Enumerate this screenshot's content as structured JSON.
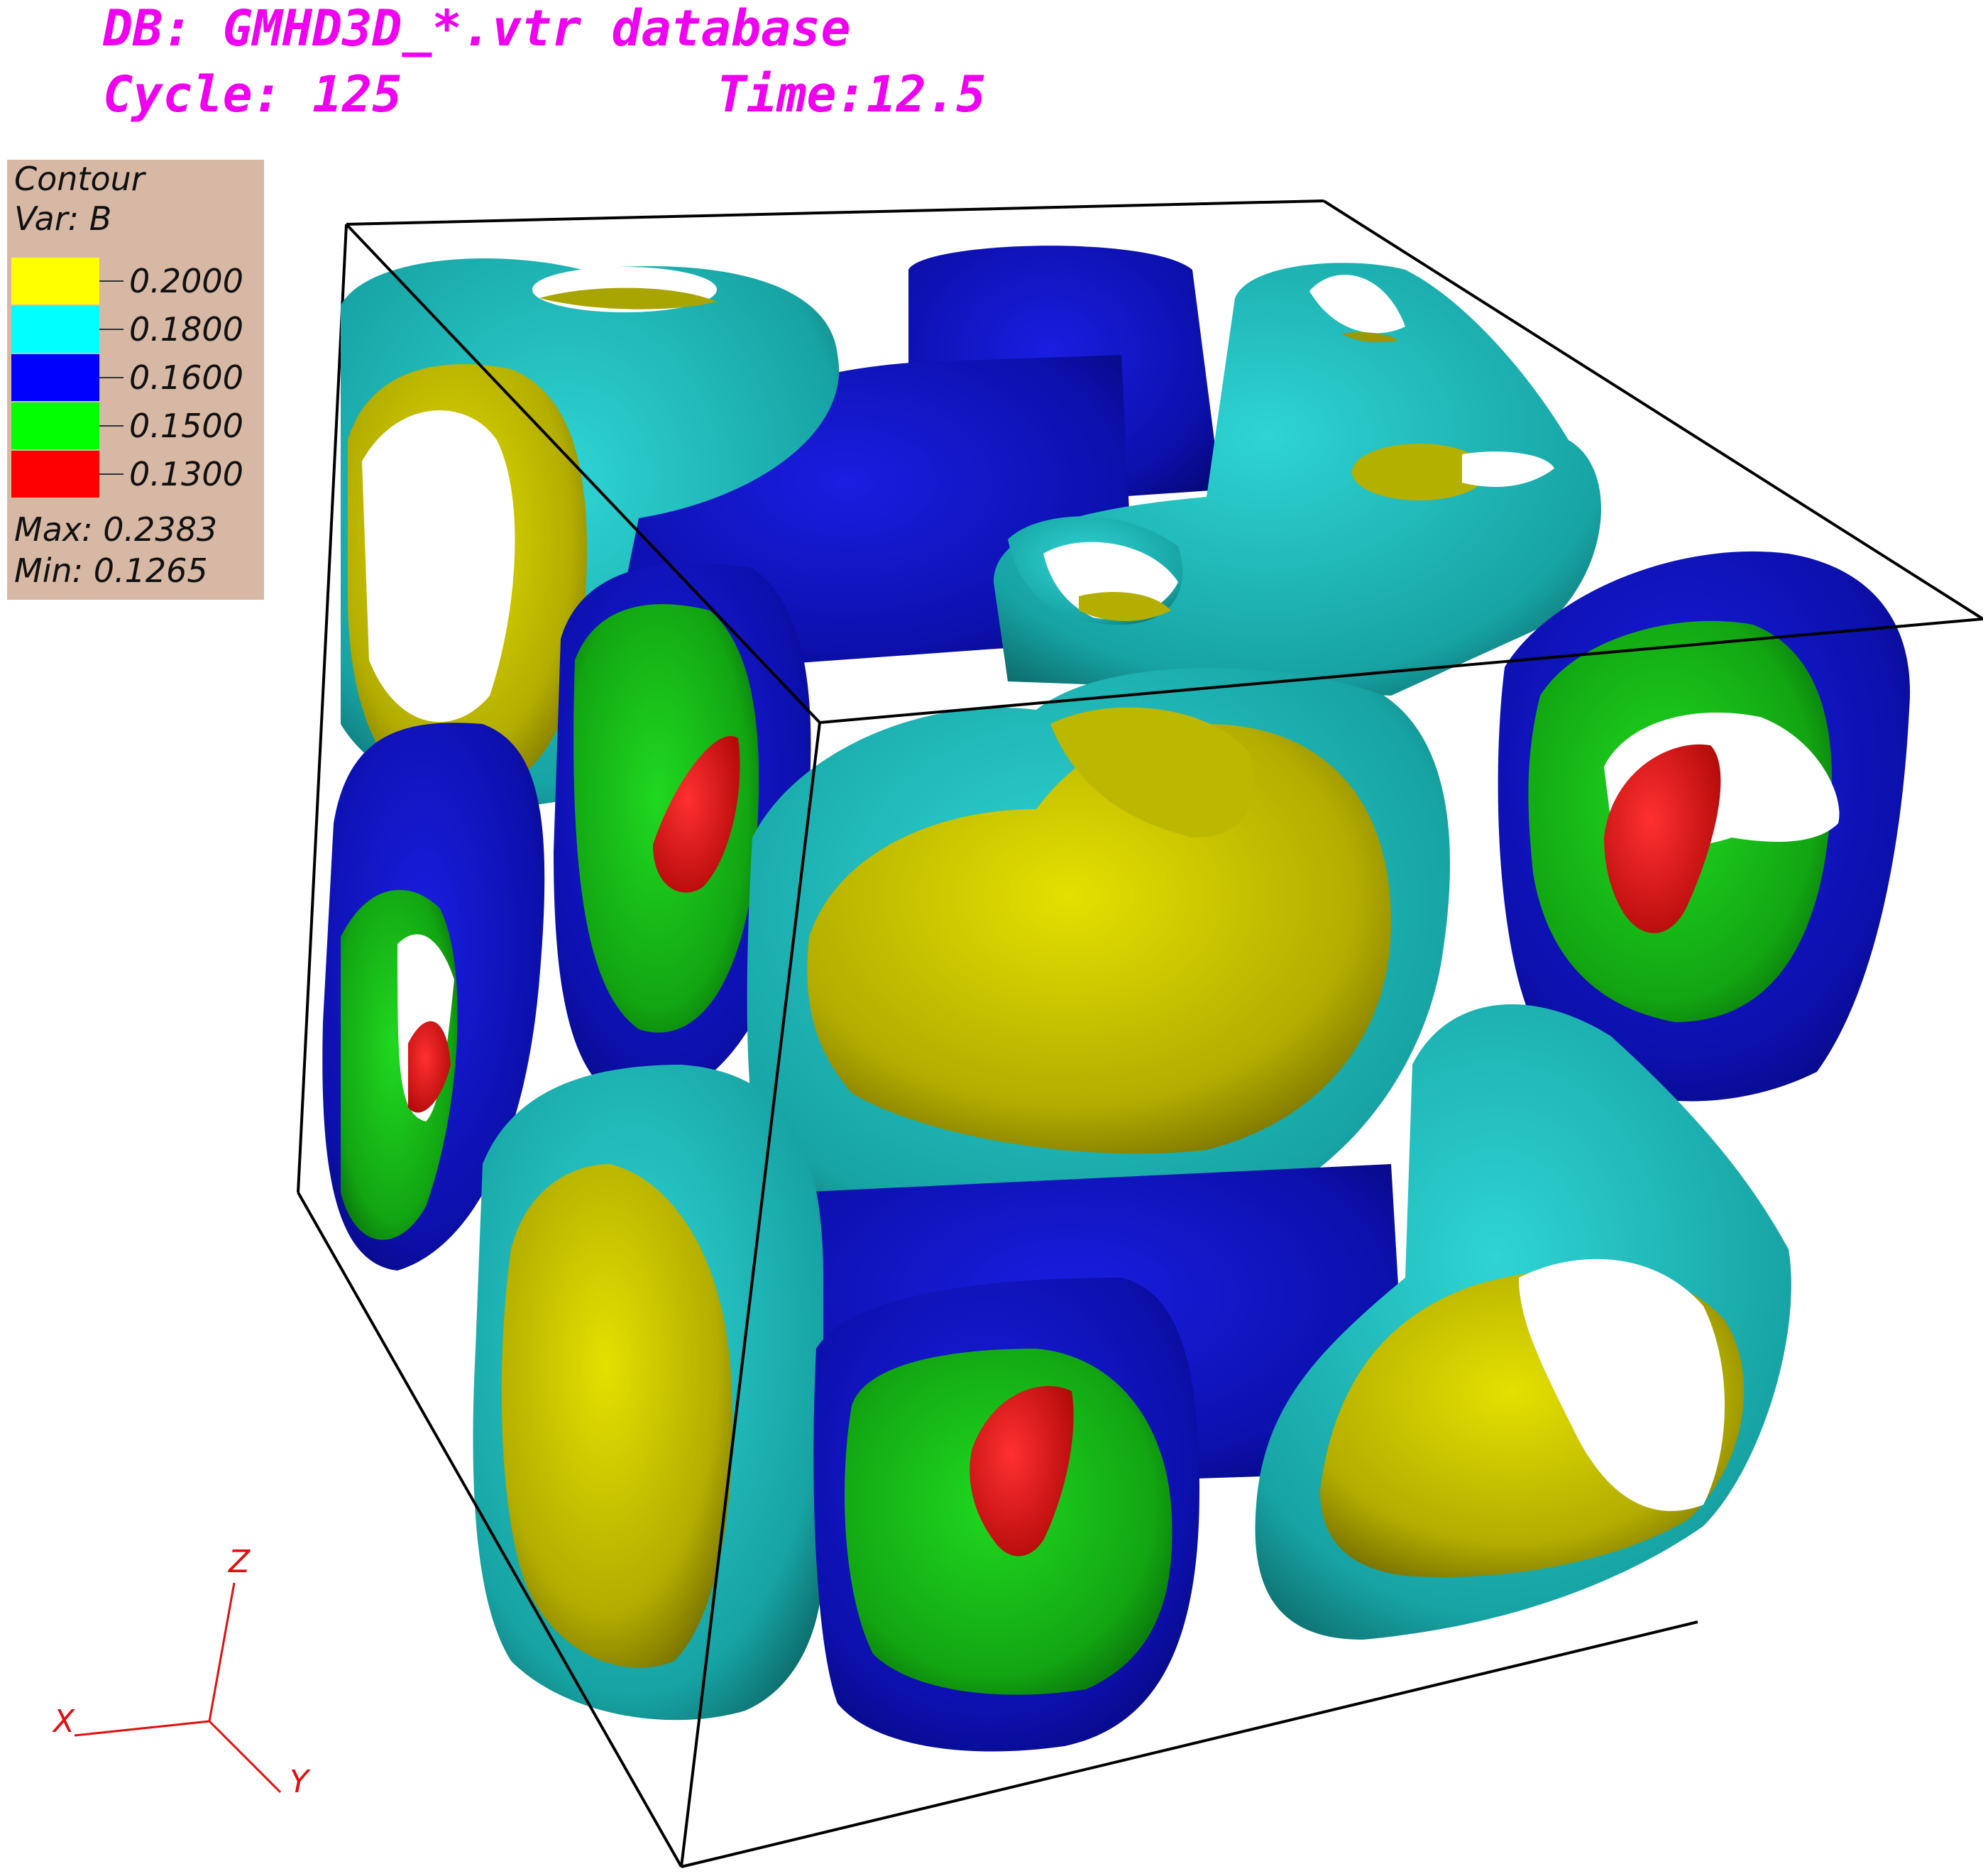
{
  "header": {
    "db_line": "DB: GMHD3D_*.vtr database",
    "cycle_label": "Cycle: 125",
    "time_label": "Time:12.5"
  },
  "legend": {
    "title": "Contour",
    "variable": "Var: B",
    "levels": [
      {
        "value": "0.2000",
        "color": "#ffff00"
      },
      {
        "value": "0.1800",
        "color": "#00ffff"
      },
      {
        "value": "0.1600",
        "color": "#0000ff"
      },
      {
        "value": "0.1500",
        "color": "#00ff00"
      },
      {
        "value": "0.1300",
        "color": "#ff0000"
      }
    ],
    "max_label": "Max:  0.2383",
    "min_label": "Min:  0.1265"
  },
  "axes_triad": {
    "x_label": "X",
    "y_label": "Y",
    "z_label": "Z",
    "color": "#e01010"
  },
  "surface_colors": {
    "yellow": "#c8c400",
    "cyan": "#1fb8b8",
    "blue": "#0c10b0",
    "green": "#16b016",
    "red": "#e80e0e"
  }
}
